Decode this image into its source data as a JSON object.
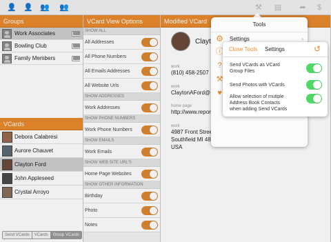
{
  "toolbar": {
    "icons": [
      "add-person-icon",
      "person-icon",
      "group-icon",
      "add-group-icon",
      "tools-icon",
      "vcard-icon",
      "share-icon",
      "dollar-icon"
    ]
  },
  "groups": {
    "header": "Groups",
    "items": [
      {
        "label": "Work Associates",
        "selected": true
      },
      {
        "label": "Bowling Club",
        "selected": false
      },
      {
        "label": "Family Members",
        "selected": false
      }
    ]
  },
  "vcards": {
    "header": "VCards",
    "items": [
      {
        "label": "Debora Calabresi",
        "selected": false
      },
      {
        "label": "Aurore Chauvet",
        "selected": false
      },
      {
        "label": "Clayton Ford",
        "selected": true
      },
      {
        "label": "John Appleseed",
        "selected": false
      },
      {
        "label": "Crystal Arroyo",
        "selected": false
      }
    ]
  },
  "bottom_tabs": [
    {
      "label": "Send VCards",
      "active": false
    },
    {
      "label": "VCards",
      "active": false
    },
    {
      "label": "Group VCards",
      "active": true
    }
  ],
  "options": {
    "header": "VCard View Options",
    "sections": [
      {
        "title": "SHOW ALL",
        "rows": [
          "All Addresses",
          "All Phone Numbers",
          "All Emails Addresses",
          "All Website Urls"
        ]
      },
      {
        "title": "SHOW ADDRESSES",
        "rows": [
          "Work Addresses"
        ]
      },
      {
        "title": "SHOW PHONE NUMBERS",
        "rows": [
          "Work Phone Numbers"
        ]
      },
      {
        "title": "SHOW EMAILS",
        "rows": [
          "Work Emails"
        ]
      },
      {
        "title": "SHOW WEB SITE URL'S",
        "rows": [
          "Home Page Websites"
        ]
      },
      {
        "title": "SHOW OTHER INFORMATION",
        "rows": [
          "Birthday",
          "Photo",
          "Notes"
        ]
      }
    ]
  },
  "detail": {
    "header": "Modified VCard",
    "name": "Clayt",
    "fields": [
      {
        "label": "work",
        "lines": [
          "(810) 458-2507"
        ]
      },
      {
        "label": "work",
        "lines": [
          "ClaytonAFord@"
        ]
      },
      {
        "label": "home page",
        "lines": [
          "http://www.reportquo"
        ]
      },
      {
        "label": "work",
        "lines": [
          "4987 Front Street",
          "Southfield MI 48075",
          "USA"
        ]
      }
    ]
  },
  "tools_popover": {
    "title": "Tools",
    "settings_label": "Settings"
  },
  "settings_popover": {
    "close_label": "Close Tools",
    "title": "Settings",
    "rows": [
      {
        "text_lines": [
          "Send VCards as VCard",
          "Group Files"
        ],
        "on": true
      },
      {
        "text_lines": [
          "Send Photos with VCards"
        ],
        "on": true
      },
      {
        "text_lines": [
          "Allow selection of mutiple",
          "Address Book Contacts",
          "when adding Send VCards"
        ],
        "on": true
      }
    ]
  },
  "colors": {
    "accent": "#e98a2d",
    "toggle_green": "#4cd964"
  }
}
